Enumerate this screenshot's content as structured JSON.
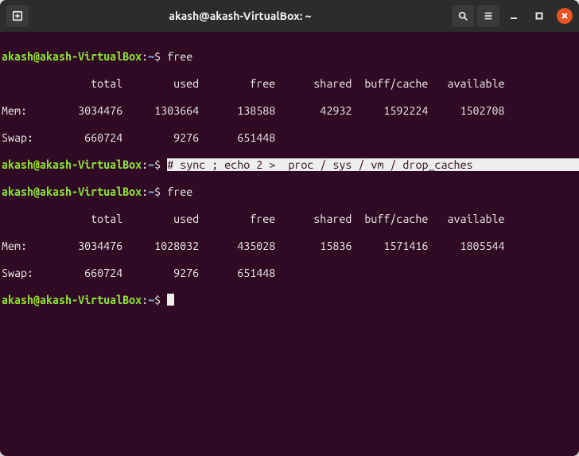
{
  "titlebar": {
    "title": "akash@akash-VirtualBox: ~"
  },
  "prompt": {
    "host": "akash@akash-VirtualBox",
    "sep1": ":",
    "path": "~",
    "sep2": "$"
  },
  "commands": {
    "free1": "free",
    "dropcaches": "# sync ; echo 2 >  proc / sys / vm / drop_caches",
    "free2": "free"
  },
  "free_header": "              total        used        free      shared  buff/cache   available",
  "free1_mem": "Mem:        3034476     1303664      138588       42932     1592224     1502708",
  "free1_swap": "Swap:        660724        9276      651448",
  "free2_mem": "Mem:        3034476     1028032      435028       15836     1571416     1805544",
  "free2_swap": "Swap:        660724        9276      651448",
  "chart_data": {
    "type": "table",
    "title": "free command output (memory in KB)",
    "columns": [
      "",
      "total",
      "used",
      "free",
      "shared",
      "buff/cache",
      "available"
    ],
    "before": [
      {
        "row": "Mem",
        "total": 3034476,
        "used": 1303664,
        "free": 138588,
        "shared": 42932,
        "buff_cache": 1592224,
        "available": 1502708
      },
      {
        "row": "Swap",
        "total": 660724,
        "used": 9276,
        "free": 651448,
        "shared": null,
        "buff_cache": null,
        "available": null
      }
    ],
    "after": [
      {
        "row": "Mem",
        "total": 3034476,
        "used": 1028032,
        "free": 435028,
        "shared": 15836,
        "buff_cache": 1571416,
        "available": 1805544
      },
      {
        "row": "Swap",
        "total": 660724,
        "used": 9276,
        "free": 651448,
        "shared": null,
        "buff_cache": null,
        "available": null
      }
    ]
  }
}
